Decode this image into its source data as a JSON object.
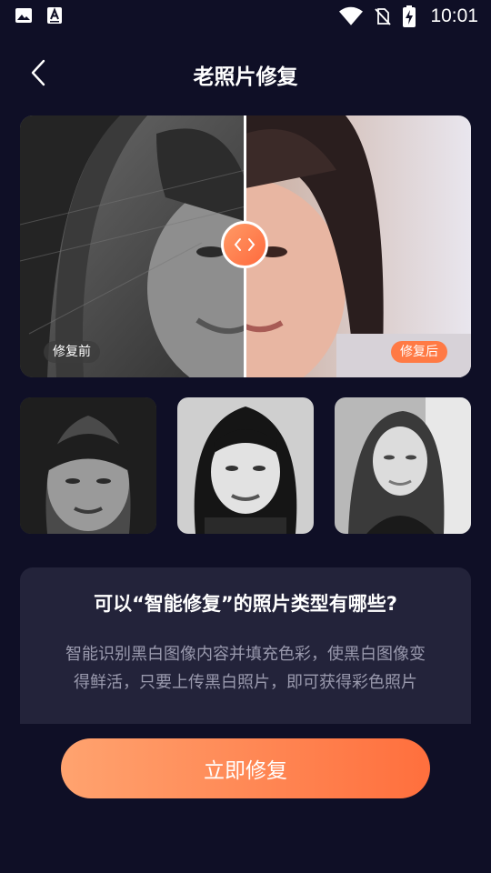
{
  "status_bar": {
    "time": "10:01",
    "left_icons": [
      "image-icon",
      "text-a-icon"
    ],
    "right_icons": [
      "wifi-icon",
      "no-sim-icon",
      "battery-charging-icon"
    ]
  },
  "nav": {
    "title": "老照片修复",
    "back_icon": "chevron-left-icon"
  },
  "compare": {
    "before_label": "修复前",
    "after_label": "修复后",
    "handle_icon": "left-right-arrows-icon"
  },
  "thumbnails": [
    {
      "name": "photo-thumb-1"
    },
    {
      "name": "photo-thumb-2"
    },
    {
      "name": "photo-thumb-3"
    }
  ],
  "info": {
    "title": "可以“智能修复”的照片类型有哪些?",
    "body": "智能识别黑白图像内容并填充色彩，使黑白图像变得鲜活，只要上传黑白照片，即可获得彩色照片"
  },
  "cta": {
    "label": "立即修复"
  },
  "colors": {
    "background": "#0f0f26",
    "card": "#23233a",
    "accent_start": "#ffa36f",
    "accent_end": "#ff6f3d",
    "muted_text": "#9a9aae"
  }
}
